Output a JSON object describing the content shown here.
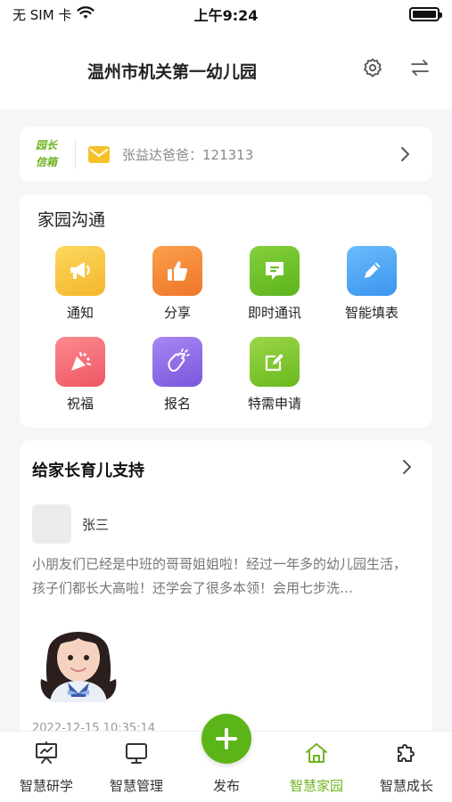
{
  "status_bar": {
    "carrier": "无 SIM 卡",
    "time": "上午9:24"
  },
  "header": {
    "title": "温州市机关第一幼儿园",
    "icons": [
      "gear-icon",
      "switch-icon"
    ]
  },
  "mailbox": {
    "badge_line1": "园长",
    "badge_line2": "信箱",
    "message": "张益达爸爸：121313"
  },
  "home_school": {
    "title": "家园沟通",
    "items": [
      {
        "label": "通知",
        "icon": "megaphone-icon",
        "color": "#f8c53a"
      },
      {
        "label": "分享",
        "icon": "thumbs-up-icon",
        "color": "#f5892f"
      },
      {
        "label": "即时通讯",
        "icon": "chat-icon",
        "color": "#6cc12a"
      },
      {
        "label": "智能填表",
        "icon": "pencil-icon",
        "color": "#4aa6f5"
      },
      {
        "label": "祝福",
        "icon": "party-popper-icon",
        "color": "#f46d75"
      },
      {
        "label": "报名",
        "icon": "clap-icon",
        "color": "#8f6ae6"
      },
      {
        "label": "特需申请",
        "icon": "edit-icon",
        "color": "#7cc623"
      }
    ]
  },
  "parent_support": {
    "title": "给家长育儿支持",
    "author": "张三",
    "text": "小朋友们已经是中班的哥哥姐姐啦！经过一年多的幼儿园生活，孩子们都长大高啦！还学会了很多本领！会用七步洗…",
    "time": "2022-12-15 10:35:14"
  },
  "tab_bar": {
    "tabs": [
      {
        "label": "智慧研学",
        "icon": "presentation-icon"
      },
      {
        "label": "智慧管理",
        "icon": "monitor-icon"
      },
      {
        "label": "发布",
        "icon": "plus-icon"
      },
      {
        "label": "智慧家园",
        "icon": "home-icon",
        "active": true
      },
      {
        "label": "智慧成长",
        "icon": "puzzle-icon"
      }
    ],
    "accent": "#6fb31f"
  }
}
